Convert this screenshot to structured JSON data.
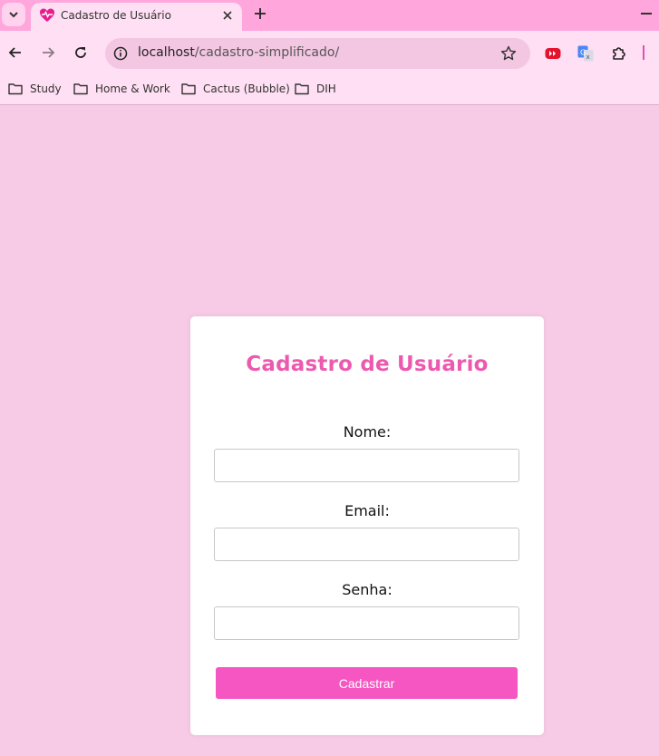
{
  "browser": {
    "tab_title": "Cadastro de Usuário",
    "url_host": "localhost",
    "url_path": "/cadastro-simplificado/",
    "bookmarks": [
      {
        "label": "Study"
      },
      {
        "label": "Home & Work"
      },
      {
        "label": "Cactus (Bubble)"
      },
      {
        "label": "DIH"
      }
    ],
    "icons": {
      "tab_menu": "chevron-down-icon",
      "favicon": "heart-pulse-icon",
      "close": "close-icon",
      "new_tab": "plus-icon",
      "back": "arrow-left-icon",
      "forward": "arrow-right-icon",
      "reload": "reload-icon",
      "site_info": "info-icon",
      "bookmark_star": "star-icon",
      "extensions": [
        "youtube-extension-icon",
        "google-translate-icon",
        "puzzle-icon"
      ],
      "bookmark_folder": "folder-icon"
    }
  },
  "form": {
    "title": "Cadastro de Usuário",
    "fields": [
      {
        "label": "Nome:",
        "value": "",
        "placeholder": ""
      },
      {
        "label": "Email:",
        "value": "",
        "placeholder": ""
      },
      {
        "label": "Senha:",
        "value": "",
        "placeholder": ""
      }
    ],
    "submit_label": "Cadastrar"
  },
  "colors": {
    "page_background": "#f7cbe5",
    "accent": "#ec5aaf",
    "button": "#f556c1",
    "chrome": "#ffdff3",
    "tabstrip": "#ffa6dc"
  }
}
